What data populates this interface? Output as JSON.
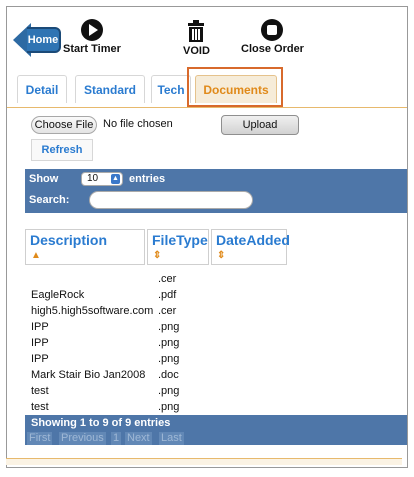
{
  "toolbar": {
    "home_label": "Home",
    "start_timer_label": "Start Timer",
    "void_label": "VOID",
    "close_order_label": "Close Order"
  },
  "tabs": [
    {
      "label": "Detail"
    },
    {
      "label": "Standard"
    },
    {
      "label": "Tech"
    },
    {
      "label": "Documents",
      "active": true
    }
  ],
  "upload": {
    "choose_file_label": "Choose File",
    "no_file_text": "No file chosen",
    "upload_label": "Upload",
    "refresh_label": "Refresh"
  },
  "table_controls": {
    "show_label": "Show",
    "entries_value": "10",
    "entries_label": "entries",
    "search_label": "Search:",
    "search_value": ""
  },
  "table": {
    "columns": [
      "Description",
      "FileType",
      "DateAdded"
    ],
    "rows": [
      {
        "description": "",
        "filetype": ".cer"
      },
      {
        "description": "EagleRock",
        "filetype": ".pdf"
      },
      {
        "description": "high5.high5software.com",
        "filetype": ".cer"
      },
      {
        "description": "IPP",
        "filetype": ".png"
      },
      {
        "description": "IPP",
        "filetype": ".png"
      },
      {
        "description": "IPP",
        "filetype": ".png"
      },
      {
        "description": "Mark Stair Bio Jan2008",
        "filetype": ".doc"
      },
      {
        "description": "test",
        "filetype": ".png"
      },
      {
        "description": "test",
        "filetype": ".png"
      }
    ],
    "info": "Showing 1 to 9 of 9 entries",
    "pager": {
      "first": "First",
      "previous": "Previous",
      "page": "1",
      "next": "Next",
      "last": "Last"
    }
  },
  "colors": {
    "accent": "#e08a1a",
    "link": "#2a7bd0",
    "bar": "#4e76a8"
  }
}
